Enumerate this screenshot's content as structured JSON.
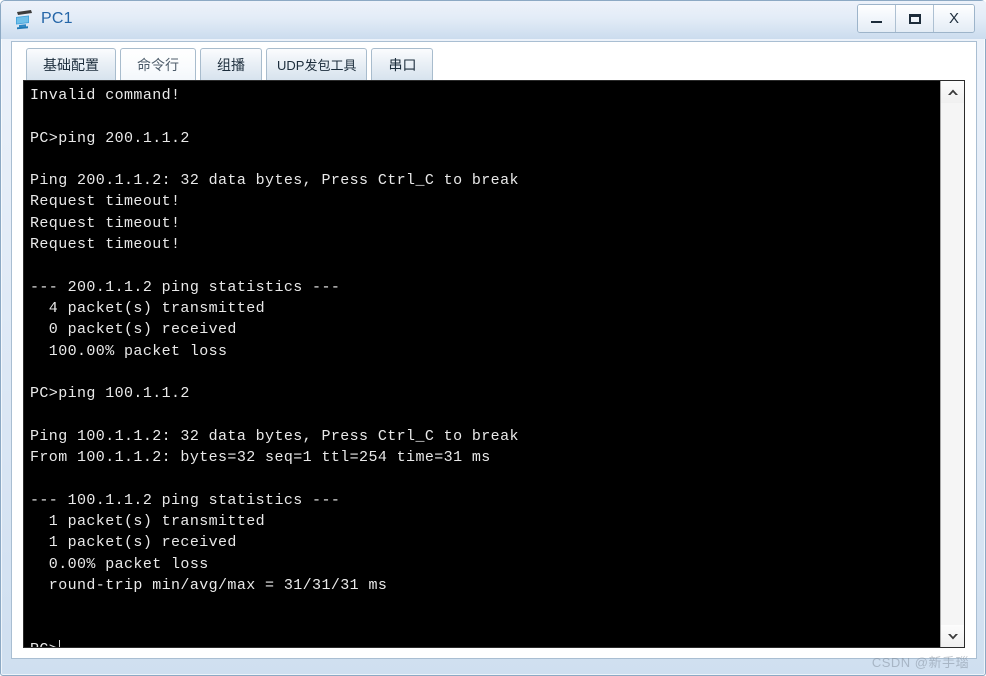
{
  "window": {
    "title": "PC1",
    "icon": "pc-monitor-icon",
    "accent_color": "#2566a8",
    "titlebar_color": "#dde8f5",
    "controls": {
      "minimize_label": "–",
      "maximize_label": "❐",
      "close_label": "X"
    }
  },
  "tabs": [
    {
      "label": "基础配置",
      "name": "tab-basic-config",
      "active": false,
      "wide": false
    },
    {
      "label": "命令行",
      "name": "tab-command-line",
      "active": true,
      "wide": false
    },
    {
      "label": "组播",
      "name": "tab-multicast",
      "active": false,
      "wide": false
    },
    {
      "label": "UDP发包工具",
      "name": "tab-udp-tool",
      "active": false,
      "wide": true
    },
    {
      "label": "串口",
      "name": "tab-serial-port",
      "active": false,
      "wide": false
    }
  ],
  "terminal": {
    "background_color": "#000000",
    "text_color": "#e9e9e9",
    "prompt": "PC>",
    "lines": [
      "Invalid command!",
      "",
      "PC>ping 200.1.1.2",
      "",
      "Ping 200.1.1.2: 32 data bytes, Press Ctrl_C to break",
      "Request timeout!",
      "Request timeout!",
      "Request timeout!",
      "",
      "--- 200.1.1.2 ping statistics ---",
      "  4 packet(s) transmitted",
      "  0 packet(s) received",
      "  100.00% packet loss",
      "",
      "PC>ping 100.1.1.2",
      "",
      "Ping 100.1.1.2: 32 data bytes, Press Ctrl_C to break",
      "From 100.1.1.2: bytes=32 seq=1 ttl=254 time=31 ms",
      "",
      "--- 100.1.1.2 ping statistics ---",
      "  1 packet(s) transmitted",
      "  1 packet(s) received",
      "  0.00% packet loss",
      "  round-trip min/avg/max = 31/31/31 ms",
      "",
      ""
    ],
    "cursor_line": "PC>"
  },
  "scrollbar": {
    "up_arrow": "chevron-up-icon",
    "down_arrow": "chevron-down-icon"
  },
  "watermark": {
    "text": "CSDN @新手瑙"
  }
}
